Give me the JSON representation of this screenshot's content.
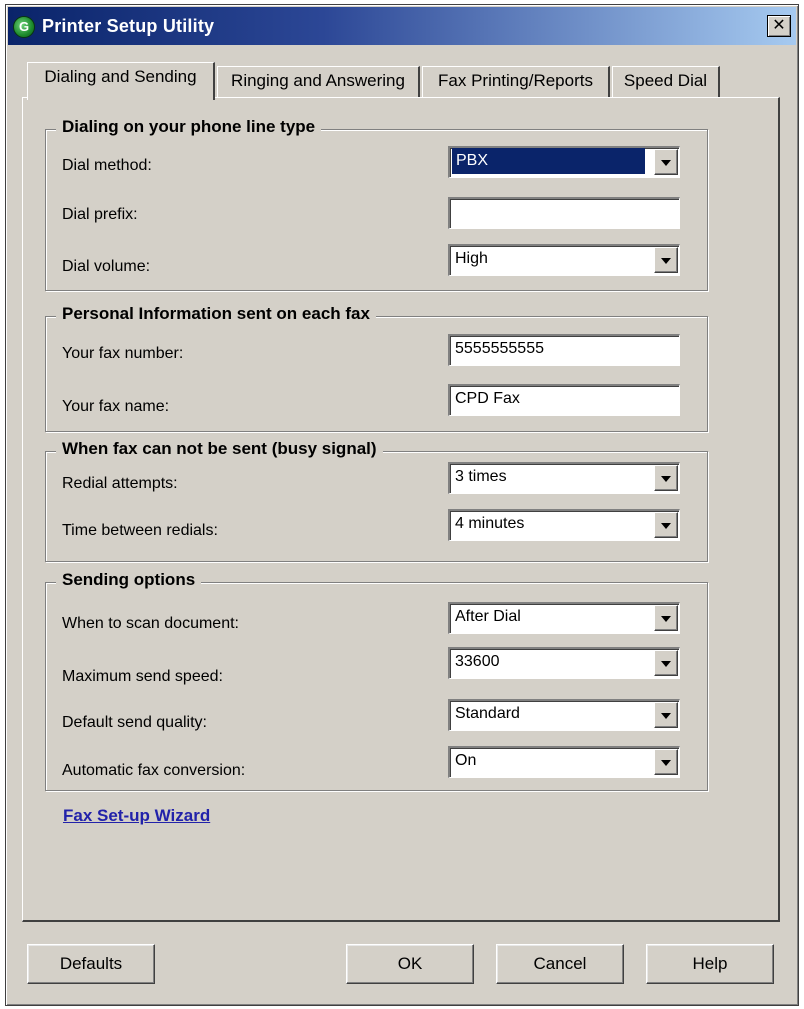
{
  "window": {
    "title": "Printer Setup Utility",
    "close_glyph": "✕",
    "icon": "printer-setup-icon"
  },
  "tabs": [
    {
      "label": "Dialing and Sending",
      "active": true
    },
    {
      "label": "Ringing and Answering",
      "active": false
    },
    {
      "label": "Fax Printing/Reports",
      "active": false
    },
    {
      "label": "Speed Dial",
      "active": false
    }
  ],
  "dialing": {
    "legend": "Dialing on your phone line type",
    "dial_method_label": "Dial method:",
    "dial_method_value": "PBX",
    "dial_prefix_label": "Dial prefix:",
    "dial_prefix_value": "",
    "dial_volume_label": "Dial volume:",
    "dial_volume_value": "High"
  },
  "personal": {
    "legend": "Personal Information sent on each fax",
    "fax_number_label": "Your fax number:",
    "fax_number_value": "5555555555",
    "fax_name_label": "Your fax name:",
    "fax_name_value": "CPD Fax"
  },
  "busy": {
    "legend": "When fax can not be sent (busy signal)",
    "redial_attempts_label": "Redial attempts:",
    "redial_attempts_value": "3 times",
    "time_between_label": "Time between redials:",
    "time_between_value": "4 minutes"
  },
  "sending": {
    "legend": "Sending options",
    "scan_label": "When to scan document:",
    "scan_value": "After Dial",
    "speed_label": "Maximum send speed:",
    "speed_value": "33600",
    "quality_label": "Default send quality:",
    "quality_value": "Standard",
    "conversion_label": "Automatic fax conversion:",
    "conversion_value": "On"
  },
  "wizard_link": "Fax Set-up Wizard",
  "buttons": {
    "defaults": "Defaults",
    "ok": "OK",
    "cancel": "Cancel",
    "help": "Help"
  },
  "colors": {
    "title_bar": "#0a246a",
    "face": "#d4d0c8",
    "selection": "#0a246a",
    "link": "#2222aa"
  }
}
